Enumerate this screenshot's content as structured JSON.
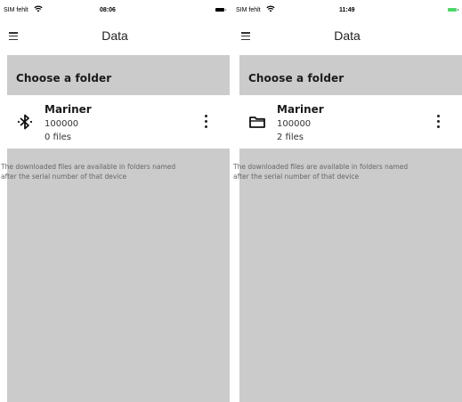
{
  "caption": "folder icon.",
  "screens": [
    {
      "status": {
        "carrier": "SIM fehlt",
        "time": "08:06",
        "battery_color": "#000000"
      },
      "header": {
        "title": "Data"
      },
      "section_title": "Choose a folder",
      "device": {
        "name": "Mariner",
        "serial": "100000",
        "files": "0 files",
        "icon": "bluetooth-icon"
      },
      "info_line1": "The downloaded files are available in folders named",
      "info_line2": "after the serial number of that device"
    },
    {
      "status": {
        "carrier": "SIM fehlt",
        "time": "11:49",
        "battery_color": "#4cd964"
      },
      "header": {
        "title": "Data"
      },
      "section_title": "Choose a folder",
      "device": {
        "name": "Mariner",
        "serial": "100000",
        "files": "2 files",
        "icon": "folder-icon"
      },
      "info_line1": "The downloaded files are available in folders named",
      "info_line2": "after the serial number of that device"
    }
  ]
}
